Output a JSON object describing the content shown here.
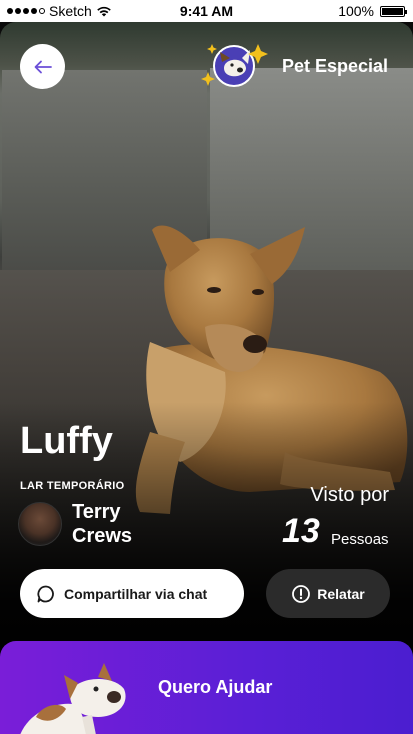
{
  "status_bar": {
    "carrier": "Sketch",
    "time": "9:41 AM",
    "battery": "100%",
    "battery_level": 1.0
  },
  "header": {
    "back_icon": "arrow-left-icon",
    "badge_icon": "dog-sparkle-icon",
    "badge_label": "Pet Especial"
  },
  "pet": {
    "name": "Luffy"
  },
  "foster": {
    "label": "LAR TEMPORÁRIO",
    "first_name": "Terry",
    "last_name": "Crews"
  },
  "views": {
    "title": "Visto por",
    "count": "13",
    "unit": "Pessoas"
  },
  "actions": {
    "share_label": "Compartilhar via chat",
    "share_icon": "chat-bubble-icon",
    "report_label": "Relatar",
    "report_icon": "alert-circle-icon"
  },
  "help": {
    "label": "Quero Ajudar",
    "icon": "dog-icon"
  },
  "colors": {
    "accent_purple": "#6A1FD6",
    "back_arrow": "#6B4FD8"
  }
}
